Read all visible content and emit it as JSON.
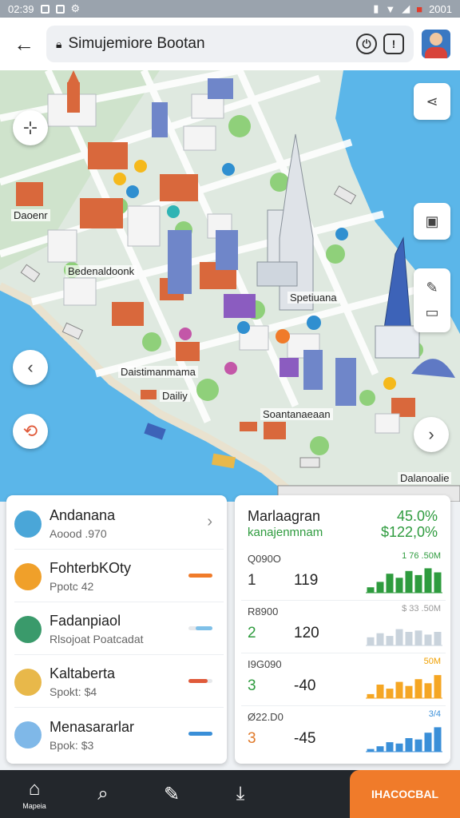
{
  "status": {
    "time": "02:39",
    "right_text": "2001"
  },
  "browser": {
    "title": "Simujemiore Bootan"
  },
  "map": {
    "labels": {
      "l1": "Daoenr",
      "l2": "Bedenaldoonk",
      "l3": "Spetiuana",
      "l4": "Daistimanmama",
      "l5": "Dailiy",
      "l6": "Soantanaeaan",
      "l7": "Dalanoalie"
    }
  },
  "list": {
    "items": [
      {
        "name": "Andanana",
        "sub": "Aoood .970",
        "color": "#f0c7a0",
        "bar": "#e6e8eb",
        "bar_fill": 0.0
      },
      {
        "name": "FohterbKOty",
        "sub": "Ppotc 42",
        "color": "#f0a02a",
        "bar": "#f07b2a",
        "bar_fill": 1.0
      },
      {
        "name": "Fadanpiaol",
        "sub": "Rlsojoat Poatcadat",
        "color": "#3a9a6b",
        "bar": "#7fc0e8",
        "bar_fill": 0.7
      },
      {
        "name": "Kaltaberta",
        "sub": "Spokt: $4",
        "color": "#e8b84a",
        "bar": "#e05a3a",
        "bar_fill": 0.8
      },
      {
        "name": "Menasararlar",
        "sub": "Bpok: $3",
        "color": "#7fb8e8",
        "bar": "#3a8fd8",
        "bar_fill": 1.0
      }
    ]
  },
  "stats": {
    "title": "Marlaagran",
    "subtitle": "kanajenmnam",
    "pct": "45.0%",
    "amount": "$122,0%",
    "rows": [
      {
        "code": "Q090O",
        "num": "1",
        "num_color": "#333",
        "value": "119",
        "small": "1 76 .50M",
        "small_color": "#2e9b3e",
        "bar_color": "#2e9b3e",
        "bars": [
          0.2,
          0.4,
          0.7,
          0.55,
          0.8,
          0.65,
          0.9,
          0.75
        ]
      },
      {
        "code": "R8900",
        "num": "2",
        "num_color": "#2e9b3e",
        "value": "120",
        "small": "$ 33 .50M",
        "small_color": "#999",
        "bar_color": "#c9d3dc",
        "bars": [
          0.3,
          0.45,
          0.35,
          0.6,
          0.5,
          0.55,
          0.4,
          0.5
        ]
      },
      {
        "code": "I9G090",
        "num": "3",
        "num_color": "#2e9b3e",
        "value": "-40",
        "small": "50M",
        "small_color": "#f0a000",
        "bar_color": "#f5a623",
        "bars": [
          0.15,
          0.5,
          0.35,
          0.6,
          0.45,
          0.7,
          0.55,
          0.85
        ]
      },
      {
        "code": "Ø22.D0",
        "num": "3",
        "num_color": "#e07a2a",
        "value": "-45",
        "small": "3/4",
        "small_color": "#3a8fd8",
        "bar_color": "#3a8fd8",
        "bars": [
          0.1,
          0.2,
          0.35,
          0.3,
          0.5,
          0.45,
          0.7,
          0.9
        ]
      }
    ]
  },
  "nav": {
    "home": "Mapeia",
    "cta": "IHACOCBAL"
  }
}
